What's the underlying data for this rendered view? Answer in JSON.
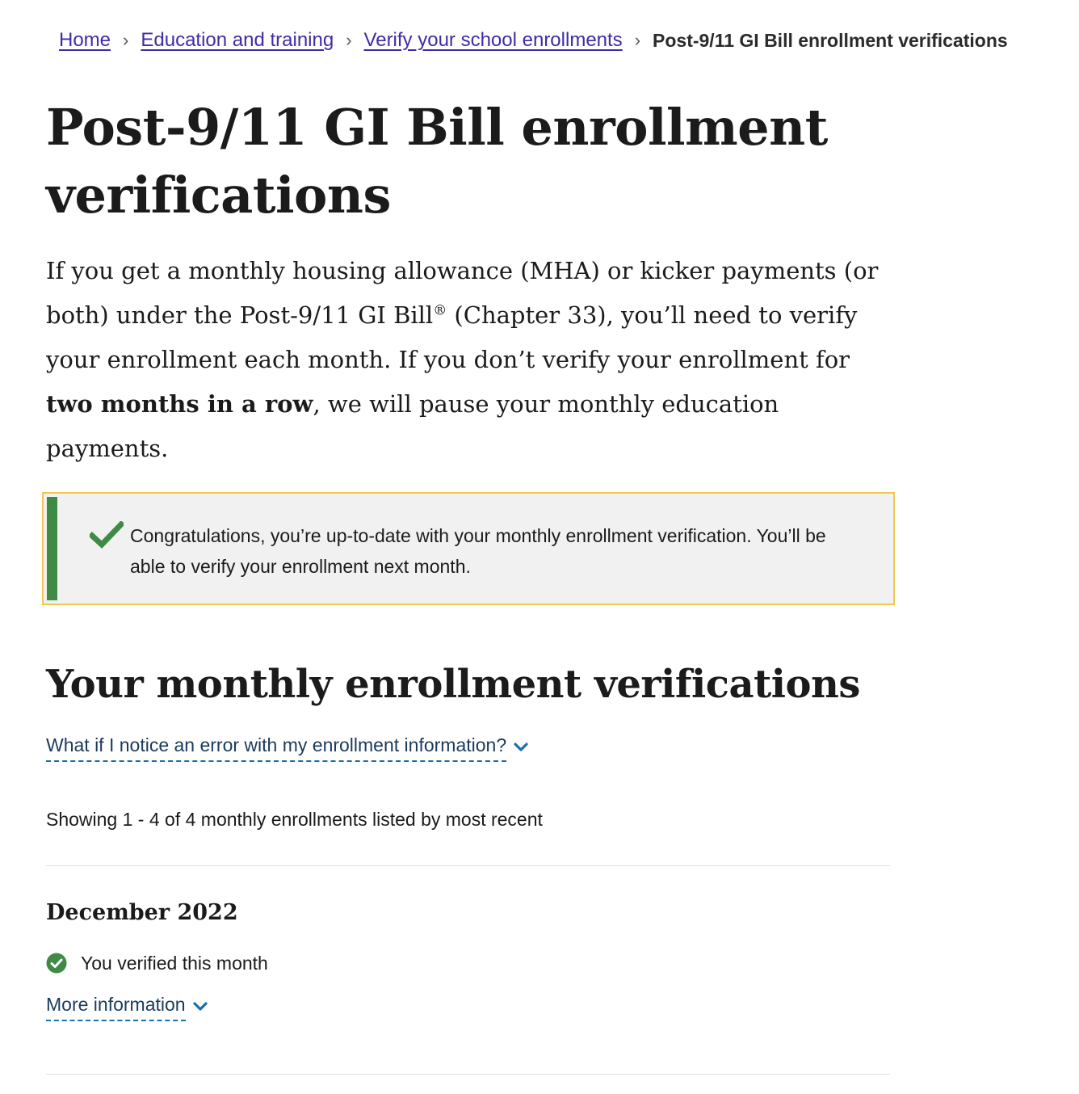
{
  "breadcrumb": {
    "items": [
      {
        "label": "Home"
      },
      {
        "label": "Education and training"
      },
      {
        "label": "Verify your school enrollments"
      }
    ],
    "separator": "›",
    "current": "Post-9/11 GI Bill enrollment verifications"
  },
  "page": {
    "title": "Post-9/11 GI Bill enrollment verifications",
    "intro": {
      "part1": "If you get a monthly housing allowance (MHA) or kicker payments (or both) under the Post-9/11 GI Bill",
      "registered_mark": "®",
      "part2": " (Chapter 33), you’ll need to verify your enrollment each month. If you don’t verify your enrollment for ",
      "emphasis": "two months in a row",
      "part3": ", we will pause your monthly education payments."
    }
  },
  "alert": {
    "icon": "check-icon",
    "message": "Congratulations, you’re up-to-date with your monthly enrollment verification. You’ll be able to verify your enrollment next month."
  },
  "verifications": {
    "heading": "Your monthly enrollment verifications",
    "error_help_label": "What if I notice an error with my enrollment information?",
    "showing_text": "Showing 1 - 4 of 4 monthly enrollments listed by most recent",
    "months": [
      {
        "title": "December 2022",
        "status": "You verified this month",
        "more_label": "More information"
      }
    ]
  },
  "colors": {
    "link": "#3d2da6",
    "success": "#3f8a44",
    "alert_border": "#f0c94a",
    "alert_bg": "#f1f1f1",
    "expander_underline": "#1b6ea8"
  }
}
